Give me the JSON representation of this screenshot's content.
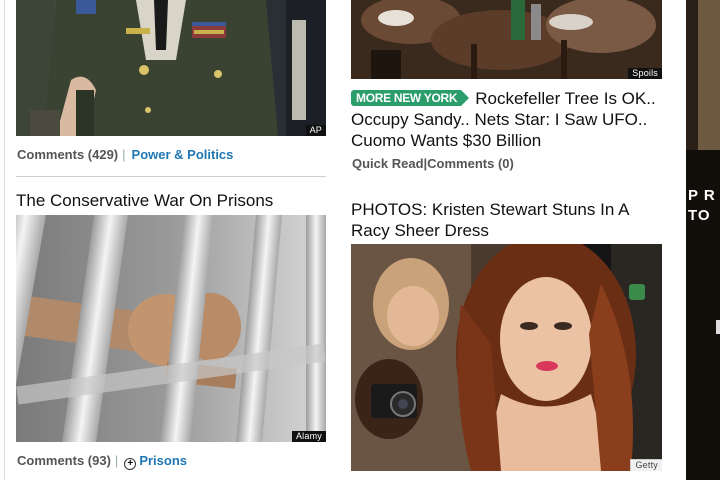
{
  "left": {
    "top_story": {
      "photo_credit": "AP",
      "comments": "Comments (429)",
      "section": "Power & Politics"
    },
    "prison_story": {
      "headline": "The Conservative War On Prisons",
      "photo_credit": "Alamy",
      "comments": "Comments (93)",
      "section": "Prisons"
    }
  },
  "middle": {
    "top_story": {
      "photo_credit": "Spoils"
    },
    "roundup": {
      "badge": "MORE NEW YORK",
      "line1": "Rockefeller Tree Is OK..",
      "line2": "Occupy Sandy.. Nets Star: I Saw UFO..",
      "line3": "Cuomo Wants $30 Billion",
      "quick_read": "Quick Read",
      "comments": "Comments (0)"
    },
    "kristen_story": {
      "headline_line1": "PHOTOS: Kristen Stewart Stuns In A",
      "headline_line2": "Racy Sheer Dress",
      "photo_credit": "Getty"
    }
  },
  "right_ad": {
    "line1": "P R",
    "line2": "TO"
  },
  "colors": {
    "link": "#1f77b4",
    "badge": "#2a9d6b"
  }
}
